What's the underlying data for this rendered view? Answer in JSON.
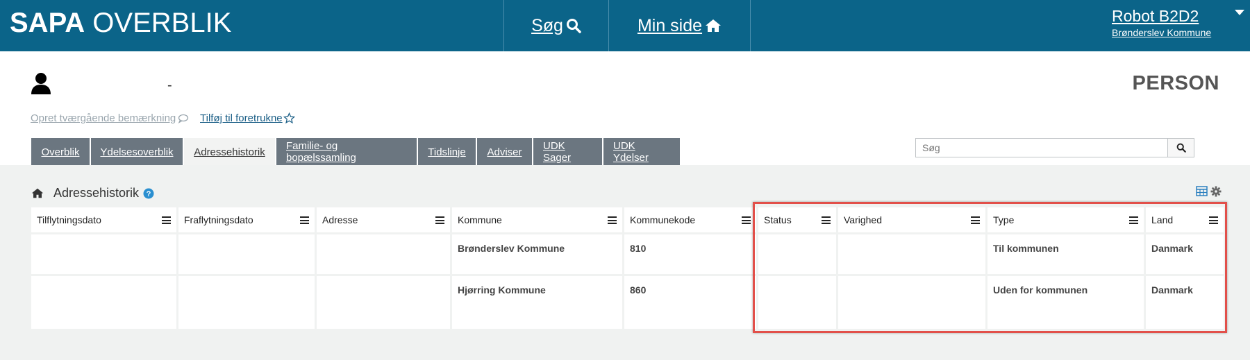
{
  "header": {
    "logo_bold": "SAPA",
    "logo_light": "OVERBLIK",
    "nav": [
      {
        "label": "Søg",
        "icon": "search-icon"
      },
      {
        "label": "Min side",
        "icon": "home-icon"
      }
    ],
    "user": {
      "name": "Robot B2D2",
      "org": "Brønderslev Kommune"
    },
    "colors": {
      "bar": "#0b6489"
    }
  },
  "person": {
    "name_placeholder": "-",
    "title": "PERSON",
    "links": {
      "remark": "Opret tværgående bemærkning",
      "favorite": "Tilføj til foretrukne"
    }
  },
  "tabs": [
    {
      "label": "Overblik",
      "active": false
    },
    {
      "label": "Ydelsesoverblik",
      "active": false
    },
    {
      "label": "Adressehistorik",
      "active": true
    },
    {
      "label": "Familie- og bopælssamling",
      "active": false
    },
    {
      "label": "Tidslinje",
      "active": false
    },
    {
      "label": "Adviser",
      "active": false
    },
    {
      "label": "UDK Sager",
      "active": false
    },
    {
      "label": "UDK Ydelser",
      "active": false
    }
  ],
  "search": {
    "placeholder": "Søg",
    "value": ""
  },
  "section": {
    "title": "Adressehistorik"
  },
  "table": {
    "columns": [
      "Tilflytningsdato",
      "Fraflytningsdato",
      "Adresse",
      "Kommune",
      "Kommunekode",
      "Status",
      "Varighed",
      "Type",
      "Land"
    ],
    "rows": [
      [
        "",
        "",
        "",
        "Brønderslev Kommune",
        "810",
        "",
        "",
        "Til kommunen",
        "Danmark"
      ],
      [
        "",
        "",
        "",
        "Hjørring Kommune",
        "860",
        "",
        "",
        "Uden for kommunen",
        "Danmark"
      ]
    ]
  },
  "highlight_color": "#e2504a"
}
